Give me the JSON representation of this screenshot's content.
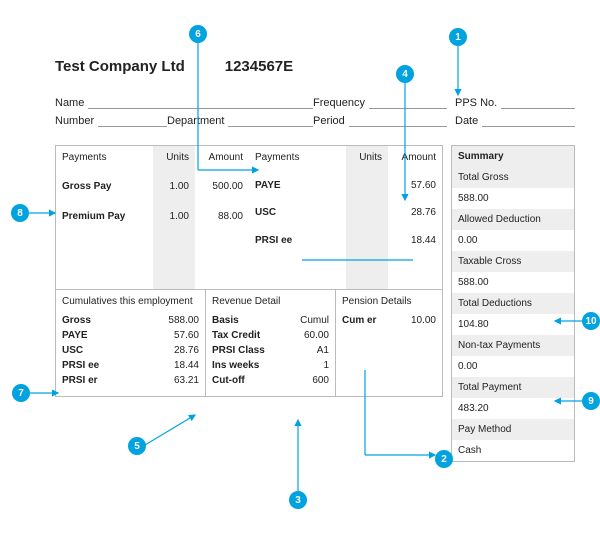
{
  "header": {
    "company": "Test Company Ltd",
    "reg_no": "1234567E"
  },
  "fields": {
    "name": "Name",
    "frequency": "Frequency",
    "pps": "PPS No.",
    "number": "Number",
    "department": "Department",
    "period": "Period",
    "date": "Date"
  },
  "payments_left": {
    "h1": "Payments",
    "h2": "Units",
    "h3": "Amount",
    "rows": [
      {
        "label": "Gross Pay",
        "units": "1.00",
        "amount": "500.00"
      },
      {
        "label": "Premium Pay",
        "units": "1.00",
        "amount": "88.00"
      }
    ]
  },
  "payments_right": {
    "h1": "Payments",
    "h2": "Units",
    "h3": "Amount",
    "rows": [
      {
        "label": "PAYE",
        "units": "",
        "amount": "57.60"
      },
      {
        "label": "USC",
        "units": "",
        "amount": "28.76"
      },
      {
        "label": "PRSI ee",
        "units": "",
        "amount": "18.44"
      }
    ]
  },
  "cumulatives": {
    "title": "Cumulatives this employment",
    "rows": [
      {
        "k": "Gross",
        "v": "588.00"
      },
      {
        "k": "PAYE",
        "v": "57.60"
      },
      {
        "k": "USC",
        "v": "28.76"
      },
      {
        "k": "PRSI ee",
        "v": "18.44"
      },
      {
        "k": "PRSI er",
        "v": "63.21"
      }
    ]
  },
  "revenue": {
    "title": "Revenue Detail",
    "rows": [
      {
        "k": "Basis",
        "v": "Cumul"
      },
      {
        "k": "Tax Credit",
        "v": "60.00"
      },
      {
        "k": "PRSI Class",
        "v": "A1"
      },
      {
        "k": "Ins weeks",
        "v": "1"
      },
      {
        "k": "Cut-off",
        "v": "600"
      }
    ]
  },
  "pension": {
    "title": "Pension Details",
    "rows": [
      {
        "k": "Cum er",
        "v": "10.00"
      }
    ]
  },
  "summary": {
    "title": "Summary",
    "items": [
      {
        "label": "Total Gross",
        "value": "588.00"
      },
      {
        "label": "Allowed Deduction",
        "value": "0.00"
      },
      {
        "label": "Taxable Cross",
        "value": "588.00"
      },
      {
        "label": "Total Deductions",
        "value": "104.80"
      },
      {
        "label": "Non-tax Payments",
        "value": "0.00"
      },
      {
        "label": "Total Payment",
        "value": "483.20"
      },
      {
        "label": "Pay Method",
        "value": "Cash"
      }
    ]
  },
  "callouts": {
    "1": "1",
    "2": "2",
    "3": "3",
    "4": "4",
    "5": "5",
    "6": "6",
    "7": "7",
    "8": "8",
    "9": "9",
    "10": "10"
  }
}
